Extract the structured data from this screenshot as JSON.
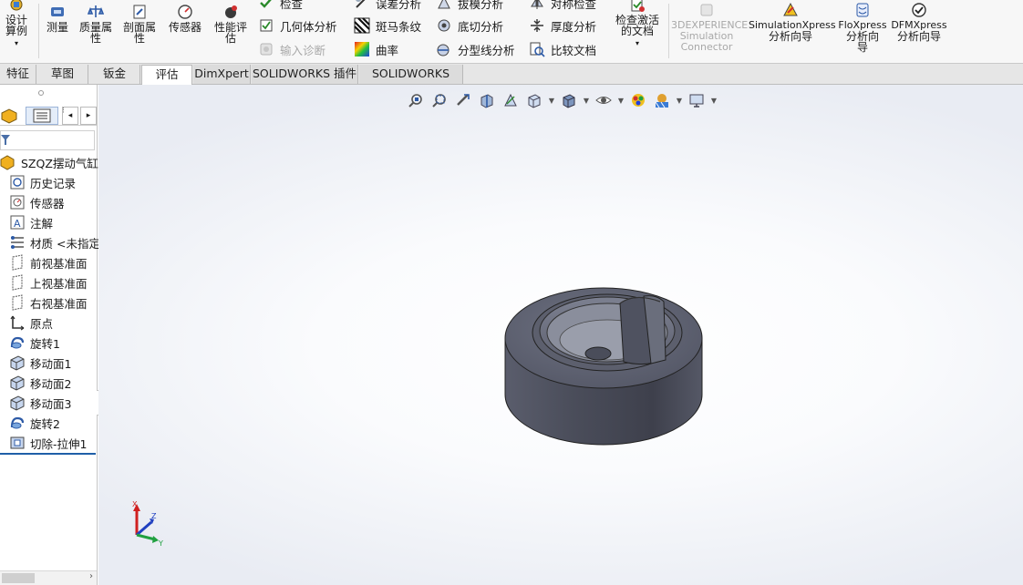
{
  "ribbon": {
    "design_study": "设计算例",
    "measure": "测量",
    "mass_props": "质量属性",
    "section_props": "剖面属性",
    "sensor": "传感器",
    "perf_eval": "性能评估",
    "check": "检查",
    "geometry_analysis": "几何体分析",
    "import_diagnostics": "输入诊断",
    "deviation_analysis": "误差分析",
    "zebra_stripes": "斑马条纹",
    "curvature": "曲率",
    "draft_analysis": "拔模分析",
    "undercut_analysis": "底切分析",
    "parting_line_analysis": "分型线分析",
    "symmetry_check": "对称检查",
    "thickness_analysis": "厚度分析",
    "compare_docs": "比较文档",
    "check_active_doc": "检查激活的文档",
    "connector_line1": "3DEXPERIENCE",
    "connector_line2": "Simulation",
    "connector_line3": "Connector",
    "simxpress_line1": "SimulationXpress",
    "simxpress_line2": "分析向导",
    "floxpress_line1": "FloXpress",
    "floxpress_line2": "分析向导",
    "dfmxpress_line1": "DFMXpress",
    "dfmxpress_line2": "分析向导"
  },
  "tabs": [
    "特征",
    "草图",
    "钣金",
    "评估",
    "DimXpert",
    "SOLIDWORKS 插件",
    "SOLIDWORKS MBD"
  ],
  "tree": {
    "root": "SZQZ摆动气缸上部",
    "items": [
      "历史记录",
      "传感器",
      "注解",
      "材质 <未指定>",
      "前视基准面",
      "上视基准面",
      "右视基准面",
      "原点",
      "旋转1",
      "移动面1",
      "移动面2",
      "移动面3",
      "旋转2",
      "切除-拉伸1"
    ]
  },
  "triad": {
    "x": "X",
    "y": "Y",
    "z": "Z"
  },
  "colors": {
    "accent": "#1f5fa8",
    "part": "#4a4d5c"
  }
}
